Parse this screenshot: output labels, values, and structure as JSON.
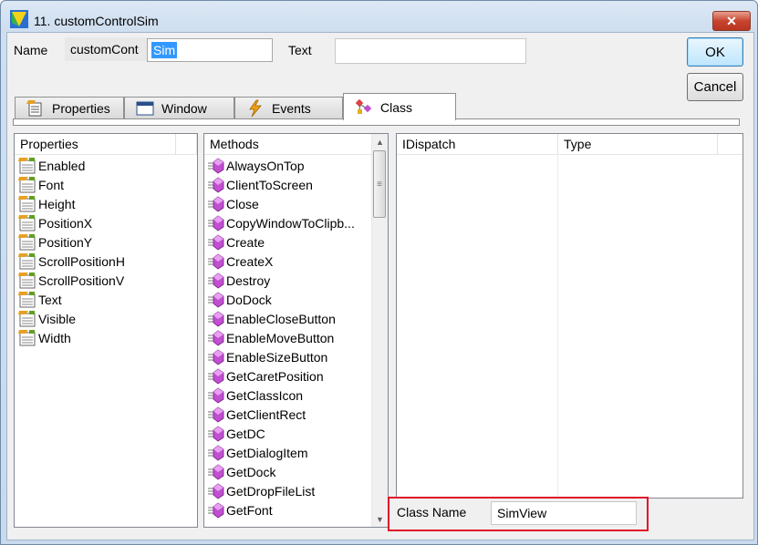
{
  "window": {
    "title": "11. customControlSim",
    "close_label": "✕"
  },
  "form": {
    "name_label": "Name",
    "name_prefix": "customCont",
    "name_selected": "Sim",
    "text_label": "Text",
    "text_value": ""
  },
  "buttons": {
    "ok": "OK",
    "cancel": "Cancel"
  },
  "tabs": [
    {
      "label": "Properties",
      "icon": "properties-icon"
    },
    {
      "label": "Window",
      "icon": "window-icon"
    },
    {
      "label": "Events",
      "icon": "lightning-icon"
    },
    {
      "label": "Class",
      "icon": "class-icon",
      "active": true
    }
  ],
  "properties_panel": {
    "header": "Properties",
    "items": [
      "Enabled",
      "Font",
      "Height",
      "PositionX",
      "PositionY",
      "ScrollPositionH",
      "ScrollPositionV",
      "Text",
      "Visible",
      "Width"
    ]
  },
  "methods_panel": {
    "header": "Methods",
    "items": [
      "AlwaysOnTop",
      "ClientToScreen",
      "Close",
      "CopyWindowToClipb...",
      "Create",
      "CreateX",
      "Destroy",
      "DoDock",
      "EnableCloseButton",
      "EnableMoveButton",
      "EnableSizeButton",
      "GetCaretPosition",
      "GetClassIcon",
      "GetClientRect",
      "GetDC",
      "GetDialogItem",
      "GetDock",
      "GetDropFileList",
      "GetFont"
    ]
  },
  "interface_panel": {
    "columns": [
      "IDispatch",
      "Type"
    ]
  },
  "class_name": {
    "label": "Class Name",
    "value": "SimView"
  },
  "colors": {
    "highlight": "#e0102a",
    "selection": "#3399ff",
    "method_icon": "#c050d0"
  }
}
